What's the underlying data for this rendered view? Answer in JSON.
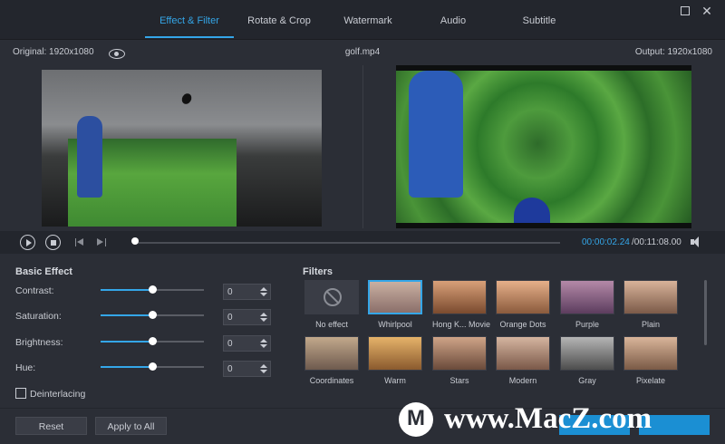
{
  "tabs": [
    {
      "label": "Effect & Filter",
      "active": true
    },
    {
      "label": "Rotate & Crop",
      "active": false
    },
    {
      "label": "Watermark",
      "active": false
    },
    {
      "label": "Audio",
      "active": false
    },
    {
      "label": "Subtitle",
      "active": false
    }
  ],
  "preview": {
    "original_label": "Original: 1920x1080",
    "file_name": "golf.mp4",
    "output_label": "Output: 1920x1080"
  },
  "playback": {
    "current_time": "00:00:02.24",
    "total_time": "/00:11:08.00",
    "progress_fraction": 0.003
  },
  "basic_effect": {
    "title": "Basic Effect",
    "controls": [
      {
        "label": "Contrast:",
        "value": "0",
        "level": 0.5
      },
      {
        "label": "Saturation:",
        "value": "0",
        "level": 0.5
      },
      {
        "label": "Brightness:",
        "value": "0",
        "level": 0.5
      },
      {
        "label": "Hue:",
        "value": "0",
        "level": 0.5
      }
    ],
    "deinterlacing_label": "Deinterlacing"
  },
  "filters": {
    "title": "Filters",
    "items": [
      {
        "name": "No effect",
        "colors": [
          "#3a3d46",
          "#3a3d46"
        ],
        "selected": false
      },
      {
        "name": "Whirlpool",
        "colors": [
          "#8b6f6a",
          "#c9b0a2"
        ],
        "selected": true
      },
      {
        "name": "Hong K... Movie",
        "colors": [
          "#7a4a2e",
          "#d8a079"
        ],
        "selected": false
      },
      {
        "name": "Orange Dots",
        "colors": [
          "#8a5a3c",
          "#e6b08a"
        ],
        "selected": false
      },
      {
        "name": "Purple",
        "colors": [
          "#5c3d5e",
          "#b489a8"
        ],
        "selected": false
      },
      {
        "name": "Plain",
        "colors": [
          "#7b5a48",
          "#d8b39a"
        ],
        "selected": false
      },
      {
        "name": "Coordinates",
        "colors": [
          "#6e5a4e",
          "#c2a98c"
        ],
        "selected": false
      },
      {
        "name": "Warm",
        "colors": [
          "#8a5a2e",
          "#e6b36a"
        ],
        "selected": false
      },
      {
        "name": "Stars",
        "colors": [
          "#6a4a3a",
          "#cfa488"
        ],
        "selected": false
      },
      {
        "name": "Modern",
        "colors": [
          "#7a5848",
          "#d5b5a0"
        ],
        "selected": false
      },
      {
        "name": "Gray",
        "colors": [
          "#4d4d4d",
          "#b5b5b5"
        ],
        "selected": false
      },
      {
        "name": "Pixelate",
        "colors": [
          "#7a5a46",
          "#d9b59a"
        ],
        "selected": false
      }
    ]
  },
  "buttons": {
    "reset": "Reset",
    "apply_all": "Apply to All"
  },
  "watermark": "www.MacZ.com"
}
